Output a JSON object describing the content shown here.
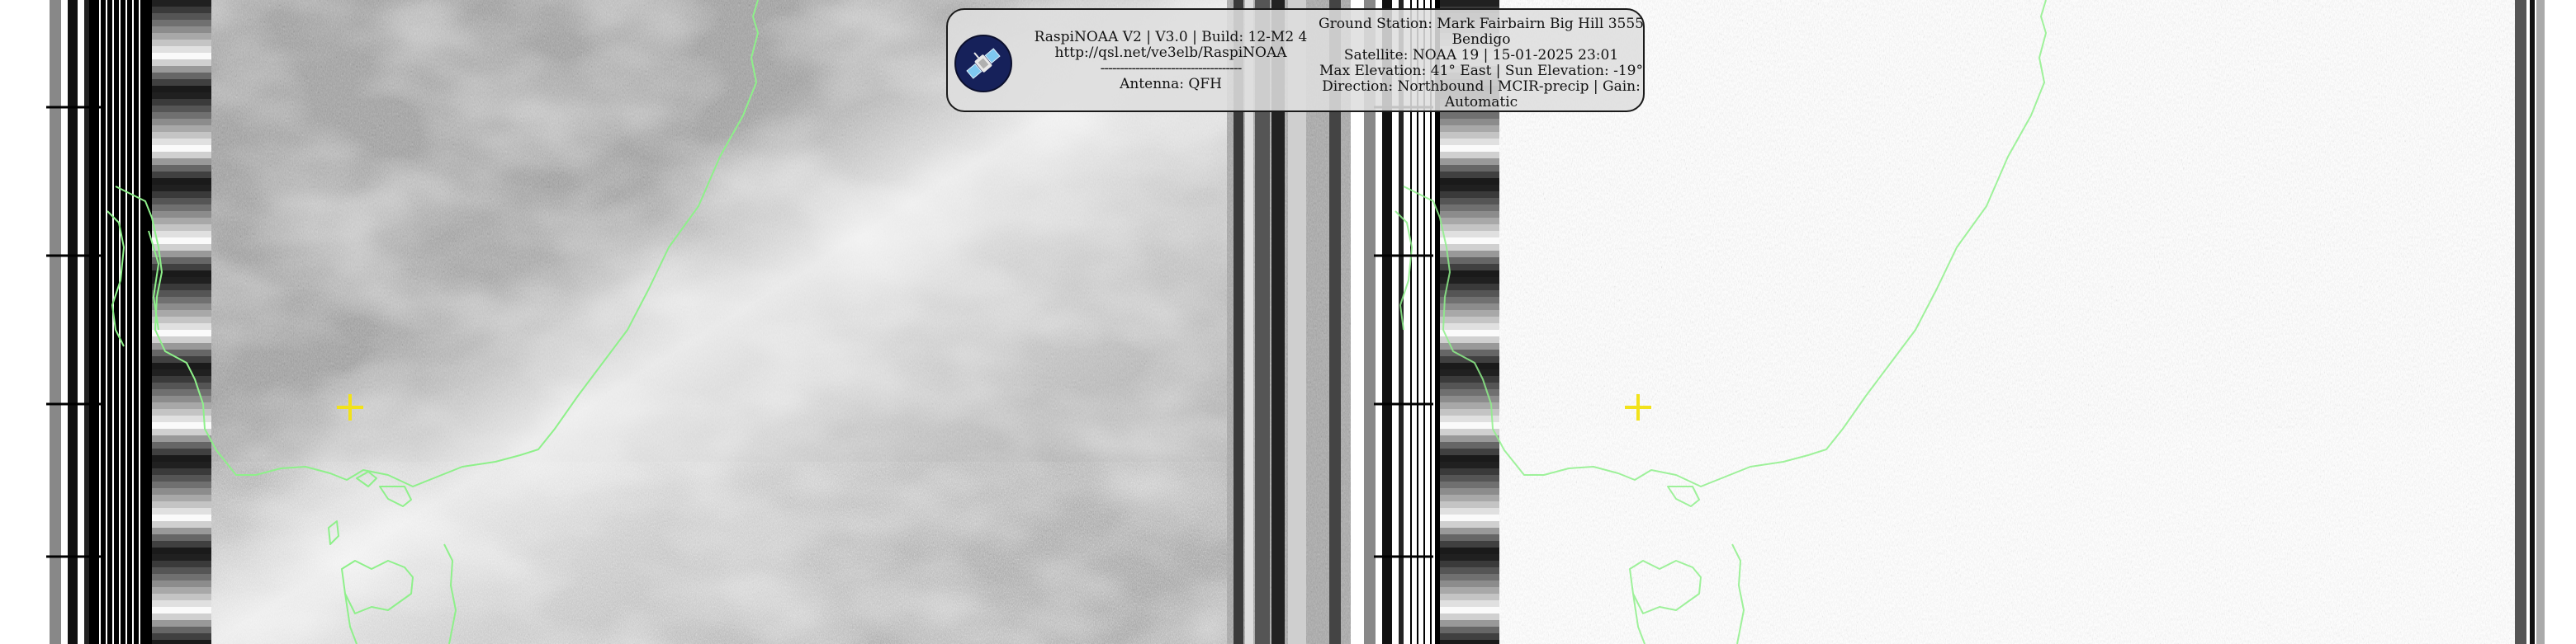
{
  "info": {
    "left_lines": [
      "RaspiNOAA V2 | V3.0 | Build: 12-M2 4",
      "http://qsl.net/ve3elb/RaspiNOAA",
      "------------------------------------",
      "Antenna: QFH"
    ],
    "right_lines": [
      "Ground Station: Mark Fairbairn Big Hill 3555 Bendigo",
      "Satellite: NOAA 19 | 15-01-2025 23:01",
      "Max Elevation: 41° East | Sun Elevation: -19°",
      "Direction: Northbound | MCIR-precip | Gain: Automatic"
    ]
  },
  "logo_icon": "satellite-icon",
  "colors": {
    "coastline": "#8ef08a",
    "marker": "#f2e21a"
  }
}
